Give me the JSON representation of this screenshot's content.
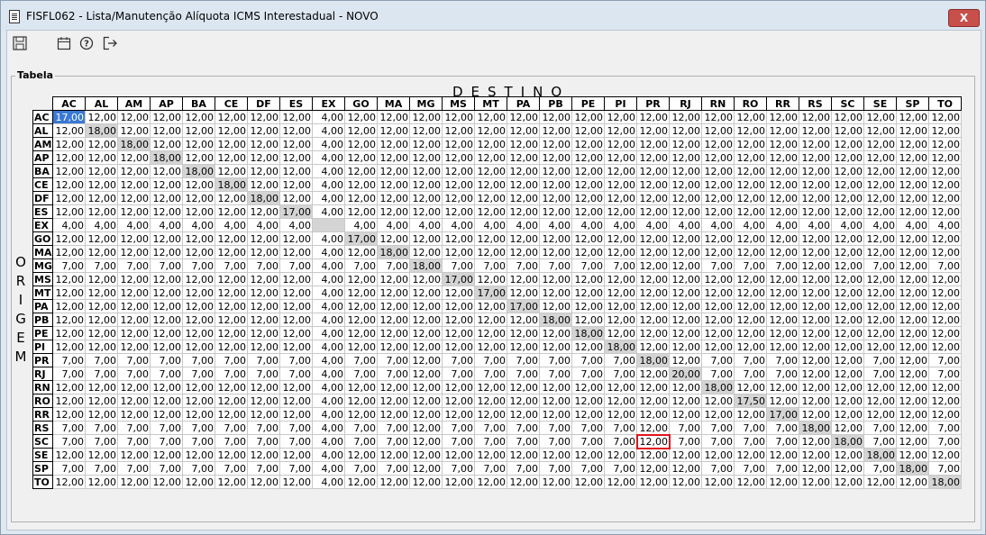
{
  "window": {
    "title": "FISFL062 - Lista/Manutenção Alíquota ICMS Interestadual - NOVO",
    "close_label": "X"
  },
  "toolbar": {
    "icons": [
      "save-icon",
      "calendar-icon",
      "help-icon",
      "exit-icon"
    ]
  },
  "group": {
    "label": "Tabela"
  },
  "destino_label": "DESTINO",
  "origem_label": "ORIGEM",
  "states": [
    "AC",
    "AL",
    "AM",
    "AP",
    "BA",
    "CE",
    "DF",
    "ES",
    "EX",
    "GO",
    "MA",
    "MG",
    "MS",
    "MT",
    "PA",
    "PB",
    "PE",
    "PI",
    "PR",
    "RJ",
    "RN",
    "RO",
    "RR",
    "RS",
    "SC",
    "SE",
    "SP",
    "TO"
  ],
  "rows": [
    {
      "origin": "AC",
      "values": [
        "17,00",
        "12,00",
        "12,00",
        "12,00",
        "12,00",
        "12,00",
        "12,00",
        "12,00",
        "4,00",
        "12,00",
        "12,00",
        "12,00",
        "12,00",
        "12,00",
        "12,00",
        "12,00",
        "12,00",
        "12,00",
        "12,00",
        "12,00",
        "12,00",
        "12,00",
        "12,00",
        "12,00",
        "12,00",
        "12,00",
        "12,00",
        "12,00"
      ]
    },
    {
      "origin": "AL",
      "values": [
        "12,00",
        "18,00",
        "12,00",
        "12,00",
        "12,00",
        "12,00",
        "12,00",
        "12,00",
        "4,00",
        "12,00",
        "12,00",
        "12,00",
        "12,00",
        "12,00",
        "12,00",
        "12,00",
        "12,00",
        "12,00",
        "12,00",
        "12,00",
        "12,00",
        "12,00",
        "12,00",
        "12,00",
        "12,00",
        "12,00",
        "12,00",
        "12,00"
      ]
    },
    {
      "origin": "AM",
      "values": [
        "12,00",
        "12,00",
        "18,00",
        "12,00",
        "12,00",
        "12,00",
        "12,00",
        "12,00",
        "4,00",
        "12,00",
        "12,00",
        "12,00",
        "12,00",
        "12,00",
        "12,00",
        "12,00",
        "12,00",
        "12,00",
        "12,00",
        "12,00",
        "12,00",
        "12,00",
        "12,00",
        "12,00",
        "12,00",
        "12,00",
        "12,00",
        "12,00"
      ]
    },
    {
      "origin": "AP",
      "values": [
        "12,00",
        "12,00",
        "12,00",
        "18,00",
        "12,00",
        "12,00",
        "12,00",
        "12,00",
        "4,00",
        "12,00",
        "12,00",
        "12,00",
        "12,00",
        "12,00",
        "12,00",
        "12,00",
        "12,00",
        "12,00",
        "12,00",
        "12,00",
        "12,00",
        "12,00",
        "12,00",
        "12,00",
        "12,00",
        "12,00",
        "12,00",
        "12,00"
      ]
    },
    {
      "origin": "BA",
      "values": [
        "12,00",
        "12,00",
        "12,00",
        "12,00",
        "18,00",
        "12,00",
        "12,00",
        "12,00",
        "4,00",
        "12,00",
        "12,00",
        "12,00",
        "12,00",
        "12,00",
        "12,00",
        "12,00",
        "12,00",
        "12,00",
        "12,00",
        "12,00",
        "12,00",
        "12,00",
        "12,00",
        "12,00",
        "12,00",
        "12,00",
        "12,00",
        "12,00"
      ]
    },
    {
      "origin": "CE",
      "values": [
        "12,00",
        "12,00",
        "12,00",
        "12,00",
        "12,00",
        "18,00",
        "12,00",
        "12,00",
        "4,00",
        "12,00",
        "12,00",
        "12,00",
        "12,00",
        "12,00",
        "12,00",
        "12,00",
        "12,00",
        "12,00",
        "12,00",
        "12,00",
        "12,00",
        "12,00",
        "12,00",
        "12,00",
        "12,00",
        "12,00",
        "12,00",
        "12,00"
      ]
    },
    {
      "origin": "DF",
      "values": [
        "12,00",
        "12,00",
        "12,00",
        "12,00",
        "12,00",
        "12,00",
        "18,00",
        "12,00",
        "4,00",
        "12,00",
        "12,00",
        "12,00",
        "12,00",
        "12,00",
        "12,00",
        "12,00",
        "12,00",
        "12,00",
        "12,00",
        "12,00",
        "12,00",
        "12,00",
        "12,00",
        "12,00",
        "12,00",
        "12,00",
        "12,00",
        "12,00"
      ]
    },
    {
      "origin": "ES",
      "values": [
        "12,00",
        "12,00",
        "12,00",
        "12,00",
        "12,00",
        "12,00",
        "12,00",
        "17,00",
        "4,00",
        "12,00",
        "12,00",
        "12,00",
        "12,00",
        "12,00",
        "12,00",
        "12,00",
        "12,00",
        "12,00",
        "12,00",
        "12,00",
        "12,00",
        "12,00",
        "12,00",
        "12,00",
        "12,00",
        "12,00",
        "12,00",
        "12,00"
      ]
    },
    {
      "origin": "EX",
      "values": [
        "4,00",
        "4,00",
        "4,00",
        "4,00",
        "4,00",
        "4,00",
        "4,00",
        "4,00",
        "",
        "4,00",
        "4,00",
        "4,00",
        "4,00",
        "4,00",
        "4,00",
        "4,00",
        "4,00",
        "4,00",
        "4,00",
        "4,00",
        "4,00",
        "4,00",
        "4,00",
        "4,00",
        "4,00",
        "4,00",
        "4,00",
        "4,00"
      ]
    },
    {
      "origin": "GO",
      "values": [
        "12,00",
        "12,00",
        "12,00",
        "12,00",
        "12,00",
        "12,00",
        "12,00",
        "12,00",
        "4,00",
        "17,00",
        "12,00",
        "12,00",
        "12,00",
        "12,00",
        "12,00",
        "12,00",
        "12,00",
        "12,00",
        "12,00",
        "12,00",
        "12,00",
        "12,00",
        "12,00",
        "12,00",
        "12,00",
        "12,00",
        "12,00",
        "12,00"
      ]
    },
    {
      "origin": "MA",
      "values": [
        "12,00",
        "12,00",
        "12,00",
        "12,00",
        "12,00",
        "12,00",
        "12,00",
        "12,00",
        "4,00",
        "12,00",
        "18,00",
        "12,00",
        "12,00",
        "12,00",
        "12,00",
        "12,00",
        "12,00",
        "12,00",
        "12,00",
        "12,00",
        "12,00",
        "12,00",
        "12,00",
        "12,00",
        "12,00",
        "12,00",
        "12,00",
        "12,00"
      ]
    },
    {
      "origin": "MG",
      "values": [
        "7,00",
        "7,00",
        "7,00",
        "7,00",
        "7,00",
        "7,00",
        "7,00",
        "7,00",
        "4,00",
        "7,00",
        "7,00",
        "18,00",
        "7,00",
        "7,00",
        "7,00",
        "7,00",
        "7,00",
        "7,00",
        "12,00",
        "12,00",
        "7,00",
        "7,00",
        "7,00",
        "12,00",
        "12,00",
        "7,00",
        "12,00",
        "7,00"
      ]
    },
    {
      "origin": "MS",
      "values": [
        "12,00",
        "12,00",
        "12,00",
        "12,00",
        "12,00",
        "12,00",
        "12,00",
        "12,00",
        "4,00",
        "12,00",
        "12,00",
        "12,00",
        "17,00",
        "12,00",
        "12,00",
        "12,00",
        "12,00",
        "12,00",
        "12,00",
        "12,00",
        "12,00",
        "12,00",
        "12,00",
        "12,00",
        "12,00",
        "12,00",
        "12,00",
        "12,00"
      ]
    },
    {
      "origin": "MT",
      "values": [
        "12,00",
        "12,00",
        "12,00",
        "12,00",
        "12,00",
        "12,00",
        "12,00",
        "12,00",
        "4,00",
        "12,00",
        "12,00",
        "12,00",
        "12,00",
        "17,00",
        "12,00",
        "12,00",
        "12,00",
        "12,00",
        "12,00",
        "12,00",
        "12,00",
        "12,00",
        "12,00",
        "12,00",
        "12,00",
        "12,00",
        "12,00",
        "12,00"
      ]
    },
    {
      "origin": "PA",
      "values": [
        "12,00",
        "12,00",
        "12,00",
        "12,00",
        "12,00",
        "12,00",
        "12,00",
        "12,00",
        "4,00",
        "12,00",
        "12,00",
        "12,00",
        "12,00",
        "12,00",
        "17,00",
        "12,00",
        "12,00",
        "12,00",
        "12,00",
        "12,00",
        "12,00",
        "12,00",
        "12,00",
        "12,00",
        "12,00",
        "12,00",
        "12,00",
        "12,00"
      ]
    },
    {
      "origin": "PB",
      "values": [
        "12,00",
        "12,00",
        "12,00",
        "12,00",
        "12,00",
        "12,00",
        "12,00",
        "12,00",
        "4,00",
        "12,00",
        "12,00",
        "12,00",
        "12,00",
        "12,00",
        "12,00",
        "18,00",
        "12,00",
        "12,00",
        "12,00",
        "12,00",
        "12,00",
        "12,00",
        "12,00",
        "12,00",
        "12,00",
        "12,00",
        "12,00",
        "12,00"
      ]
    },
    {
      "origin": "PE",
      "values": [
        "12,00",
        "12,00",
        "12,00",
        "12,00",
        "12,00",
        "12,00",
        "12,00",
        "12,00",
        "4,00",
        "12,00",
        "12,00",
        "12,00",
        "12,00",
        "12,00",
        "12,00",
        "12,00",
        "18,00",
        "12,00",
        "12,00",
        "12,00",
        "12,00",
        "12,00",
        "12,00",
        "12,00",
        "12,00",
        "12,00",
        "12,00",
        "12,00"
      ]
    },
    {
      "origin": "PI",
      "values": [
        "12,00",
        "12,00",
        "12,00",
        "12,00",
        "12,00",
        "12,00",
        "12,00",
        "12,00",
        "4,00",
        "12,00",
        "12,00",
        "12,00",
        "12,00",
        "12,00",
        "12,00",
        "12,00",
        "12,00",
        "18,00",
        "12,00",
        "12,00",
        "12,00",
        "12,00",
        "12,00",
        "12,00",
        "12,00",
        "12,00",
        "12,00",
        "12,00"
      ]
    },
    {
      "origin": "PR",
      "values": [
        "7,00",
        "7,00",
        "7,00",
        "7,00",
        "7,00",
        "7,00",
        "7,00",
        "7,00",
        "4,00",
        "7,00",
        "7,00",
        "12,00",
        "7,00",
        "7,00",
        "7,00",
        "7,00",
        "7,00",
        "7,00",
        "18,00",
        "12,00",
        "7,00",
        "7,00",
        "7,00",
        "12,00",
        "12,00",
        "7,00",
        "12,00",
        "7,00"
      ]
    },
    {
      "origin": "RJ",
      "values": [
        "7,00",
        "7,00",
        "7,00",
        "7,00",
        "7,00",
        "7,00",
        "7,00",
        "7,00",
        "4,00",
        "7,00",
        "7,00",
        "12,00",
        "7,00",
        "7,00",
        "7,00",
        "7,00",
        "7,00",
        "7,00",
        "12,00",
        "20,00",
        "7,00",
        "7,00",
        "7,00",
        "12,00",
        "12,00",
        "7,00",
        "12,00",
        "7,00"
      ]
    },
    {
      "origin": "RN",
      "values": [
        "12,00",
        "12,00",
        "12,00",
        "12,00",
        "12,00",
        "12,00",
        "12,00",
        "12,00",
        "4,00",
        "12,00",
        "12,00",
        "12,00",
        "12,00",
        "12,00",
        "12,00",
        "12,00",
        "12,00",
        "12,00",
        "12,00",
        "12,00",
        "18,00",
        "12,00",
        "12,00",
        "12,00",
        "12,00",
        "12,00",
        "12,00",
        "12,00"
      ]
    },
    {
      "origin": "RO",
      "values": [
        "12,00",
        "12,00",
        "12,00",
        "12,00",
        "12,00",
        "12,00",
        "12,00",
        "12,00",
        "4,00",
        "12,00",
        "12,00",
        "12,00",
        "12,00",
        "12,00",
        "12,00",
        "12,00",
        "12,00",
        "12,00",
        "12,00",
        "12,00",
        "12,00",
        "17,50",
        "12,00",
        "12,00",
        "12,00",
        "12,00",
        "12,00",
        "12,00"
      ]
    },
    {
      "origin": "RR",
      "values": [
        "12,00",
        "12,00",
        "12,00",
        "12,00",
        "12,00",
        "12,00",
        "12,00",
        "12,00",
        "4,00",
        "12,00",
        "12,00",
        "12,00",
        "12,00",
        "12,00",
        "12,00",
        "12,00",
        "12,00",
        "12,00",
        "12,00",
        "12,00",
        "12,00",
        "12,00",
        "17,00",
        "12,00",
        "12,00",
        "12,00",
        "12,00",
        "12,00"
      ]
    },
    {
      "origin": "RS",
      "values": [
        "7,00",
        "7,00",
        "7,00",
        "7,00",
        "7,00",
        "7,00",
        "7,00",
        "7,00",
        "4,00",
        "7,00",
        "7,00",
        "12,00",
        "7,00",
        "7,00",
        "7,00",
        "7,00",
        "7,00",
        "7,00",
        "12,00",
        "7,00",
        "7,00",
        "7,00",
        "7,00",
        "18,00",
        "12,00",
        "7,00",
        "12,00",
        "7,00"
      ]
    },
    {
      "origin": "SC",
      "values": [
        "7,00",
        "7,00",
        "7,00",
        "7,00",
        "7,00",
        "7,00",
        "7,00",
        "7,00",
        "4,00",
        "7,00",
        "7,00",
        "12,00",
        "7,00",
        "7,00",
        "7,00",
        "7,00",
        "7,00",
        "7,00",
        "12,00",
        "7,00",
        "7,00",
        "7,00",
        "7,00",
        "12,00",
        "18,00",
        "7,00",
        "12,00",
        "7,00"
      ]
    },
    {
      "origin": "SE",
      "values": [
        "12,00",
        "12,00",
        "12,00",
        "12,00",
        "12,00",
        "12,00",
        "12,00",
        "12,00",
        "4,00",
        "12,00",
        "12,00",
        "12,00",
        "12,00",
        "12,00",
        "12,00",
        "12,00",
        "12,00",
        "12,00",
        "12,00",
        "12,00",
        "12,00",
        "12,00",
        "12,00",
        "12,00",
        "12,00",
        "18,00",
        "12,00",
        "12,00"
      ]
    },
    {
      "origin": "SP",
      "values": [
        "7,00",
        "7,00",
        "7,00",
        "7,00",
        "7,00",
        "7,00",
        "7,00",
        "7,00",
        "4,00",
        "7,00",
        "7,00",
        "12,00",
        "7,00",
        "7,00",
        "7,00",
        "7,00",
        "7,00",
        "7,00",
        "12,00",
        "12,00",
        "7,00",
        "7,00",
        "7,00",
        "12,00",
        "12,00",
        "7,00",
        "18,00",
        "7,00"
      ]
    },
    {
      "origin": "TO",
      "values": [
        "12,00",
        "12,00",
        "12,00",
        "12,00",
        "12,00",
        "12,00",
        "12,00",
        "12,00",
        "4,00",
        "12,00",
        "12,00",
        "12,00",
        "12,00",
        "12,00",
        "12,00",
        "12,00",
        "12,00",
        "12,00",
        "12,00",
        "12,00",
        "12,00",
        "12,00",
        "12,00",
        "12,00",
        "12,00",
        "12,00",
        "12,00",
        "18,00"
      ]
    }
  ],
  "selected_cell": {
    "origin": "AC",
    "destino": "AC"
  },
  "highlighted_cell": {
    "origin": "SC",
    "destino": "PR"
  },
  "colors": {
    "selection": "#3a78d6",
    "diagonal": "#d4d4d4",
    "highlight_border": "#e0141e"
  }
}
